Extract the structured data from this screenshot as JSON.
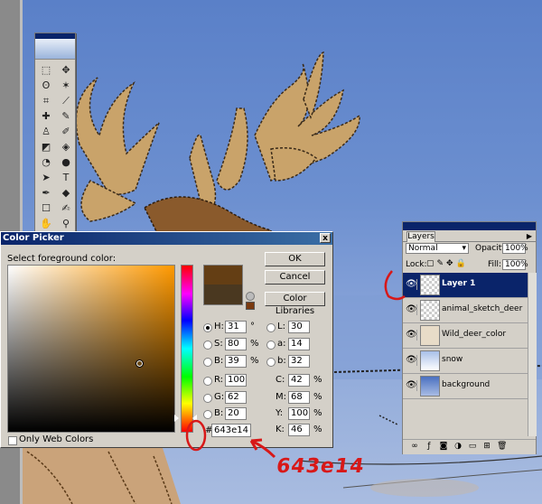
{
  "colors": {
    "foreground_hex": "#643e14",
    "accent_red": "#d81818",
    "title_blue": "#0a246a"
  },
  "toolbox": {
    "tools": [
      "marquee-tool",
      "move-tool",
      "lasso-tool",
      "magic-wand-tool",
      "crop-tool",
      "slice-tool",
      "healing-brush-tool",
      "brush-tool",
      "clone-stamp-tool",
      "history-brush-tool",
      "eraser-tool",
      "paint-bucket-tool",
      "blur-tool",
      "dodge-tool",
      "path-selection-tool",
      "type-tool",
      "pen-tool",
      "custom-shape-tool",
      "notes-tool",
      "eyedropper-tool",
      "hand-tool",
      "zoom-tool"
    ],
    "glyphs": [
      "⬚",
      "✥",
      "ʘ",
      "✶",
      "⌗",
      "⟋",
      "✚",
      "✎",
      "♙",
      "✐",
      "◩",
      "◈",
      "◔",
      "●",
      "➤",
      "T",
      "✒",
      "◆",
      "☐",
      "✍",
      "✋",
      "⚲"
    ]
  },
  "color_picker": {
    "title": "Color Picker",
    "close": "x",
    "select_label": "Select foreground color:",
    "ok": "OK",
    "cancel": "Cancel",
    "libraries": "Color Libraries",
    "hsb": [
      {
        "label": "H:",
        "value": "31",
        "unit": "°"
      },
      {
        "label": "S:",
        "value": "80",
        "unit": "%"
      },
      {
        "label": "B:",
        "value": "39",
        "unit": "%"
      }
    ],
    "rgb": [
      {
        "label": "R:",
        "value": "100"
      },
      {
        "label": "G:",
        "value": "62"
      },
      {
        "label": "B:",
        "value": "20"
      }
    ],
    "lab": [
      {
        "label": "L:",
        "value": "30"
      },
      {
        "label": "a:",
        "value": "14"
      },
      {
        "label": "b:",
        "value": "32"
      }
    ],
    "cmyk": [
      {
        "label": "C:",
        "value": "42",
        "unit": "%"
      },
      {
        "label": "M:",
        "value": "68",
        "unit": "%"
      },
      {
        "label": "Y:",
        "value": "100",
        "unit": "%"
      },
      {
        "label": "K:",
        "value": "46",
        "unit": "%"
      }
    ],
    "hash": "#",
    "hex": "643e14",
    "web_colors": "Only Web Colors"
  },
  "layers": {
    "tab": "Layers",
    "blend_mode": "Normal",
    "opacity_label": "Opacity:",
    "opacity": "100%",
    "lock_label": "Lock:",
    "fill_label": "Fill:",
    "fill": "100%",
    "items": [
      {
        "name": "Layer 1",
        "active": true
      },
      {
        "name": "animal_sketch_deer",
        "active": false
      },
      {
        "name": "Wild_deer_color",
        "active": false
      },
      {
        "name": "snow",
        "active": false
      },
      {
        "name": "background",
        "active": false
      }
    ]
  },
  "annotation": {
    "handwritten": "643e14"
  }
}
